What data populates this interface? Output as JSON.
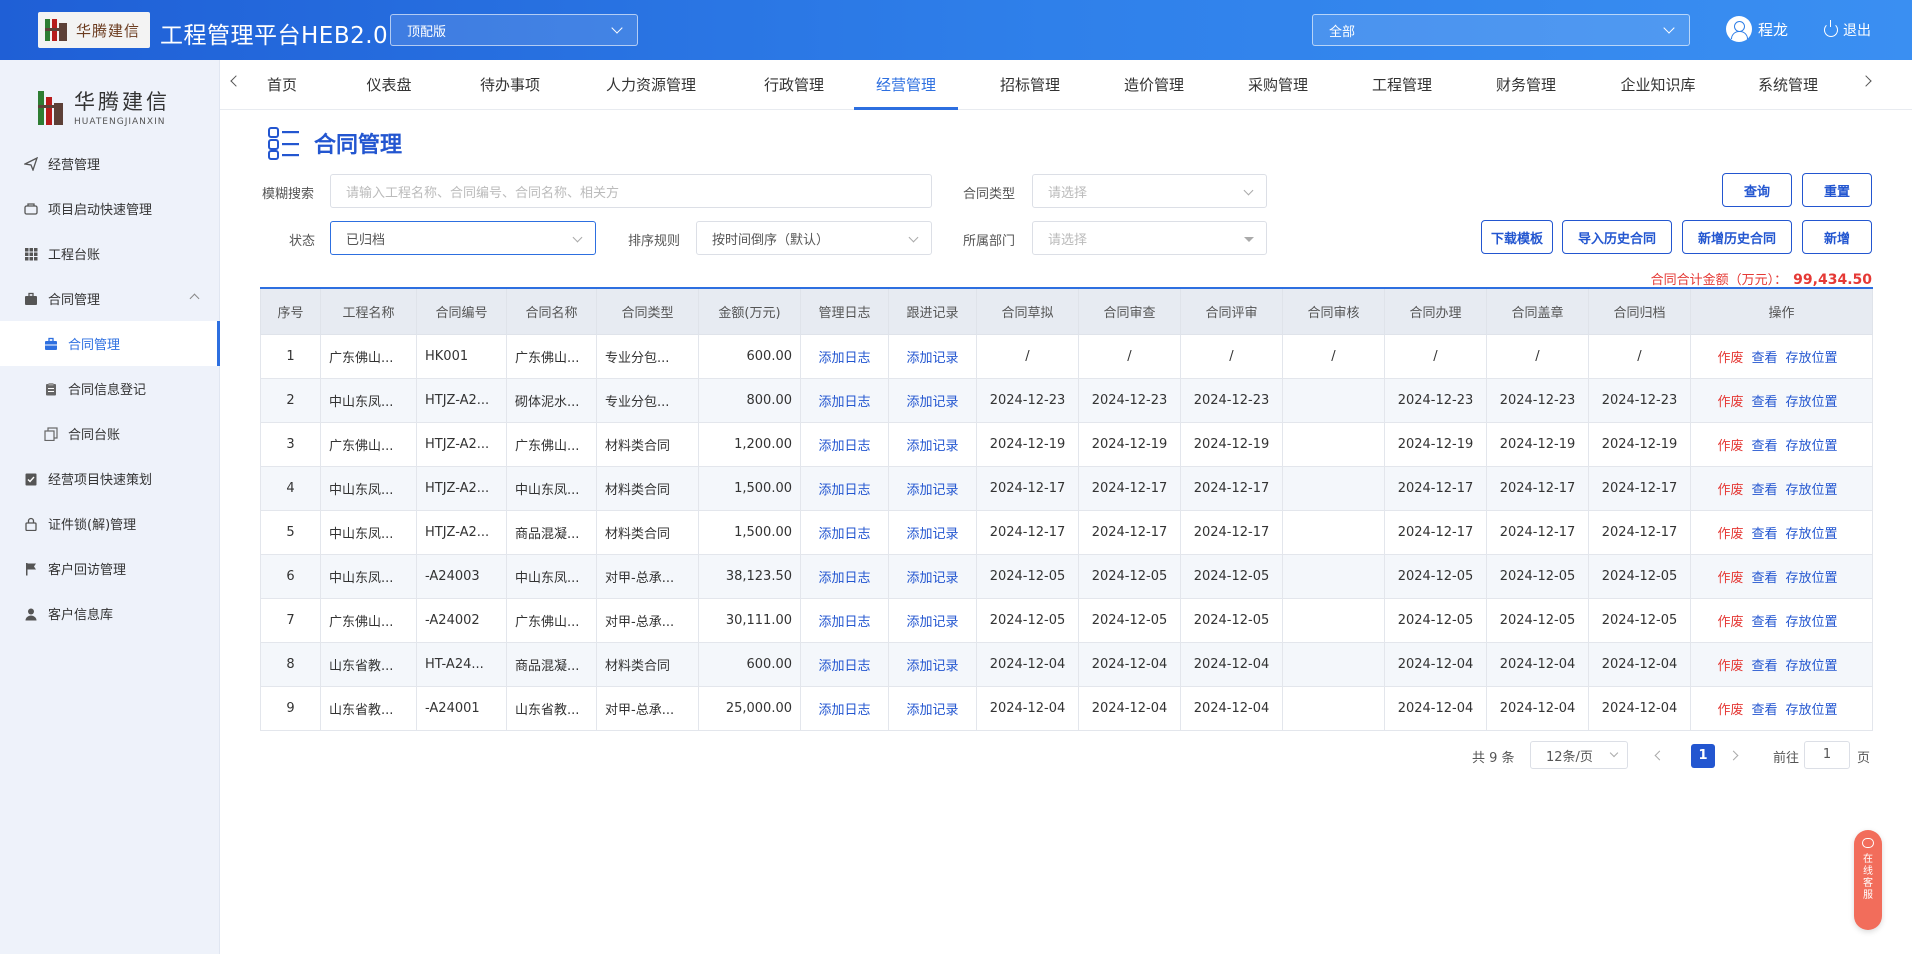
{
  "header": {
    "logo_text": "华腾建信",
    "logo_sub": "HUATENGJIANXIN",
    "app_title": "工程管理平台HEB2.0",
    "edition_select": "顶配版",
    "scope_select": "全部",
    "user_name": "程龙",
    "logout_label": "退出"
  },
  "sidebar": {
    "logo_cn": "华腾建信",
    "logo_py": "HUATENGJIANXIN",
    "items": [
      {
        "label": "经营管理",
        "icon": "send-icon"
      },
      {
        "label": "项目启动快速管理",
        "icon": "box-icon"
      },
      {
        "label": "工程台账",
        "icon": "grid-icon"
      },
      {
        "label": "合同管理",
        "icon": "briefcase-icon"
      },
      {
        "label": "合同管理",
        "icon": "briefcase-icon"
      },
      {
        "label": "合同信息登记",
        "icon": "clipboard-icon"
      },
      {
        "label": "合同台账",
        "icon": "copy-icon"
      },
      {
        "label": "经营项目快速策划",
        "icon": "checklist-icon"
      },
      {
        "label": "证件锁(解)管理",
        "icon": "lock-icon"
      },
      {
        "label": "客户回访管理",
        "icon": "flag-icon"
      },
      {
        "label": "客户信息库",
        "icon": "user-icon"
      }
    ]
  },
  "tabs": [
    "首页",
    "仪表盘",
    "待办事项",
    "人力资源管理",
    "行政管理",
    "经营管理",
    "招标管理",
    "造价管理",
    "采购管理",
    "工程管理",
    "财务管理",
    "企业知识库",
    "系统管理"
  ],
  "page": {
    "title": "合同管理",
    "filters": {
      "fuzzy_label": "模糊搜索",
      "fuzzy_placeholder": "请输入工程名称、合同编号、合同名称、相关方",
      "type_label": "合同类型",
      "type_placeholder": "请选择",
      "status_label": "状态",
      "status_value": "已归档",
      "sort_label": "排序规则",
      "sort_value": "按时间倒序（默认）",
      "dept_label": "所属部门",
      "dept_placeholder": "请选择"
    },
    "buttons": {
      "query": "查询",
      "reset": "重置",
      "download_template": "下载模板",
      "import_history": "导入历史合同",
      "add_history": "新增历史合同",
      "add": "新增"
    },
    "total_label": "合同合计金额（万元）：",
    "total_value": "99,434.50"
  },
  "table": {
    "columns": [
      "序号",
      "工程名称",
      "合同编号",
      "合同名称",
      "合同类型",
      "金额(万元)",
      "管理日志",
      "跟进记录",
      "合同草拟",
      "合同审查",
      "合同评审",
      "合同审核",
      "合同办理",
      "合同盖章",
      "合同归档",
      "操作"
    ],
    "log_link": "添加日志",
    "record_link": "添加记录",
    "actions": [
      "作废",
      "查看",
      "存放位置"
    ],
    "rows": [
      [
        "1",
        "广东佛山...",
        "HK001",
        "广东佛山...",
        "专业分包...",
        "600.00",
        "/",
        "/",
        "/",
        "/",
        "/",
        "/",
        "/"
      ],
      [
        "2",
        "中山东凤...",
        "HTJZ-A2...",
        "砌体泥水...",
        "专业分包...",
        "800.00",
        "2024-12-23",
        "2024-12-23",
        "2024-12-23",
        "",
        "2024-12-23",
        "2024-12-23",
        "2024-12-23"
      ],
      [
        "3",
        "广东佛山...",
        "HTJZ-A2...",
        "广东佛山...",
        "材料类合同",
        "1,200.00",
        "2024-12-19",
        "2024-12-19",
        "2024-12-19",
        "",
        "2024-12-19",
        "2024-12-19",
        "2024-12-19"
      ],
      [
        "4",
        "中山东凤...",
        "HTJZ-A2...",
        "中山东凤...",
        "材料类合同",
        "1,500.00",
        "2024-12-17",
        "2024-12-17",
        "2024-12-17",
        "",
        "2024-12-17",
        "2024-12-17",
        "2024-12-17"
      ],
      [
        "5",
        "中山东凤...",
        "HTJZ-A2...",
        "商品混凝...",
        "材料类合同",
        "1,500.00",
        "2024-12-17",
        "2024-12-17",
        "2024-12-17",
        "",
        "2024-12-17",
        "2024-12-17",
        "2024-12-17"
      ],
      [
        "6",
        "中山东凤...",
        "-A24003",
        "中山东凤...",
        "对甲-总承...",
        "38,123.50",
        "2024-12-05",
        "2024-12-05",
        "2024-12-05",
        "",
        "2024-12-05",
        "2024-12-05",
        "2024-12-05"
      ],
      [
        "7",
        "广东佛山...",
        "-A24002",
        "广东佛山...",
        "对甲-总承...",
        "30,111.00",
        "2024-12-05",
        "2024-12-05",
        "2024-12-05",
        "",
        "2024-12-05",
        "2024-12-05",
        "2024-12-05"
      ],
      [
        "8",
        "山东省教...",
        "HT-A24...",
        "商品混凝...",
        "材料类合同",
        "600.00",
        "2024-12-04",
        "2024-12-04",
        "2024-12-04",
        "",
        "2024-12-04",
        "2024-12-04",
        "2024-12-04"
      ],
      [
        "9",
        "山东省教...",
        "-A24001",
        "山东省教...",
        "对甲-总承...",
        "25,000.00",
        "2024-12-04",
        "2024-12-04",
        "2024-12-04",
        "",
        "2024-12-04",
        "2024-12-04",
        "2024-12-04"
      ]
    ]
  },
  "pagination": {
    "total_text": "共 9 条",
    "page_size": "12条/页",
    "current_page": "1",
    "goto_label": "前往",
    "goto_value": "1",
    "page_unit": "页"
  },
  "float_service": "在线客服",
  "colors": {
    "primary": "#2356d0",
    "danger": "#e53935",
    "header_gradient_start": "#1f5fd6"
  }
}
